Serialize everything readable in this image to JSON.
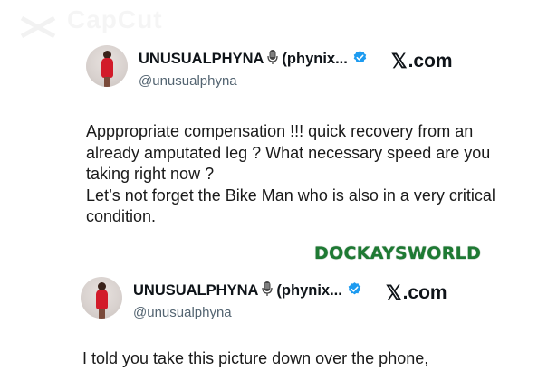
{
  "watermark_top": "CapCut",
  "tweets": [
    {
      "display_name": "UNUSUALPHYNA",
      "name_suffix": "(phynix...",
      "handle": "@unusualphyna",
      "source": ".com",
      "text": "Apppropriate compensation !!! quick recovery from an already amputated leg ? What necessary speed are you taking right now ?\nLet’s not forget the Bike Man who is also in a very critical condition."
    },
    {
      "display_name": "UNUSUALPHYNA",
      "name_suffix": "(phynix...",
      "handle": "@unusualphyna",
      "source": ".com",
      "text": "I told you take this picture down over the phone,"
    }
  ],
  "watermark": "DOCKAYSWORLD",
  "icons": {
    "mic": "microphone-icon",
    "verified": "verified-badge-icon",
    "x_logo": "x-logo-icon"
  },
  "colors": {
    "verified": "#1d9bf0",
    "watermark": "#1e7a33",
    "handle": "#536471"
  }
}
